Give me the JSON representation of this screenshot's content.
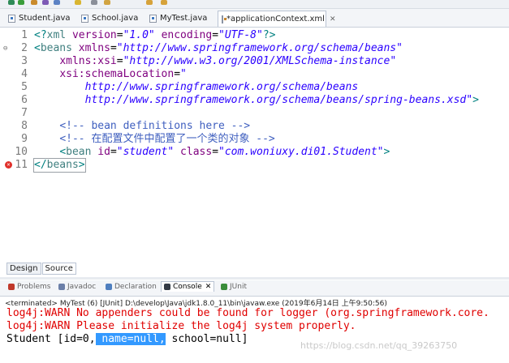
{
  "tabs": [
    {
      "label": "Student.java",
      "icon": "java-file-icon",
      "active": false
    },
    {
      "label": "School.java",
      "icon": "java-file-icon",
      "active": false
    },
    {
      "label": "MyTest.java",
      "icon": "java-file-icon",
      "active": false
    },
    {
      "label": "*applicationContext.xml",
      "icon": "xml-file-icon",
      "active": true,
      "close": "✕"
    }
  ],
  "editor": {
    "lines": [
      {
        "num": "1",
        "parts": [
          [
            "punct",
            "<?"
          ],
          [
            "tag",
            "xml "
          ],
          [
            "attr",
            "version"
          ],
          [
            "plain",
            "="
          ],
          [
            "str",
            "\"1.0\""
          ],
          [
            "plain",
            " "
          ],
          [
            "attr",
            "encoding"
          ],
          [
            "plain",
            "="
          ],
          [
            "str",
            "\"UTF-8\""
          ],
          [
            "punct",
            "?>"
          ]
        ]
      },
      {
        "num": "2",
        "fold": "⊖",
        "parts": [
          [
            "punct",
            "<"
          ],
          [
            "tag",
            "beans "
          ],
          [
            "attr",
            "xmlns"
          ],
          [
            "plain",
            "="
          ],
          [
            "str",
            "\"http://www.springframework.org/schema/beans\""
          ]
        ]
      },
      {
        "num": "3",
        "parts": [
          [
            "plain",
            "    "
          ],
          [
            "attr",
            "xmlns:xsi"
          ],
          [
            "plain",
            "="
          ],
          [
            "str",
            "\"http://www.w3.org/2001/XMLSchema-instance\""
          ]
        ]
      },
      {
        "num": "4",
        "parts": [
          [
            "plain",
            "    "
          ],
          [
            "attr",
            "xsi:schemaLocation"
          ],
          [
            "plain",
            "="
          ],
          [
            "str",
            "\""
          ]
        ]
      },
      {
        "num": "5",
        "parts": [
          [
            "plain",
            "        "
          ],
          [
            "str",
            "http://www.springframework.org/schema/beans"
          ]
        ]
      },
      {
        "num": "6",
        "parts": [
          [
            "plain",
            "        "
          ],
          [
            "str",
            "http://www.springframework.org/schema/beans/spring-beans.xsd\""
          ],
          [
            "punct",
            ">"
          ]
        ]
      },
      {
        "num": "7",
        "parts": []
      },
      {
        "num": "8",
        "parts": [
          [
            "plain",
            "    "
          ],
          [
            "cmt",
            "<!-- bean definitions here -->"
          ]
        ]
      },
      {
        "num": "9",
        "parts": [
          [
            "plain",
            "    "
          ],
          [
            "cmt",
            "<!-- 在配置文件中配置了一个类的对象 -->"
          ]
        ]
      },
      {
        "num": "10",
        "parts": [
          [
            "plain",
            "    "
          ],
          [
            "punct",
            "<"
          ],
          [
            "tag",
            "bean "
          ],
          [
            "attr",
            "id"
          ],
          [
            "plain",
            "="
          ],
          [
            "str",
            "\"student\""
          ],
          [
            "plain",
            " "
          ],
          [
            "attr",
            "class"
          ],
          [
            "plain",
            "="
          ],
          [
            "str",
            "\"com.woniuxy.di01.Student\""
          ],
          [
            "punct",
            ">"
          ]
        ]
      },
      {
        "num": "11",
        "error": true,
        "parts": [
          [
            "punct",
            "</"
          ],
          [
            "tag",
            "beans"
          ],
          [
            "punct",
            ">"
          ]
        ]
      }
    ]
  },
  "bottom_tabs": {
    "design": "Design",
    "source": "Source"
  },
  "views": [
    {
      "label": "Problems",
      "icon": "problems-icon"
    },
    {
      "label": "Javadoc",
      "icon": "javadoc-icon"
    },
    {
      "label": "Declaration",
      "icon": "declaration-icon"
    },
    {
      "label": "Console",
      "icon": "console-icon",
      "active": true,
      "close": "✕"
    },
    {
      "label": "JUnit",
      "icon": "junit-icon"
    }
  ],
  "console": {
    "status": "<terminated> MyTest (6) [JUnit] D:\\develop\\Java\\jdk1.8.0_11\\bin\\javaw.exe (2019年6月14日 上午9:50:56)",
    "line1": "log4j:WARN No appenders could be found for logger (org.springframework.core.",
    "line2": "log4j:WARN Please initialize the log4j system properly.",
    "line3_prefix": "Student [id=0,",
    "line3_selected": " name=null,",
    "line3_suffix": " school=null]"
  },
  "watermark": "https://blog.csdn.net/qq_39263750",
  "colors": {
    "tag": "#3f7f7f",
    "attr": "#7f007f",
    "string": "#2a00ff",
    "comment": "#3f5fbf",
    "warn": "#e00000",
    "selection": "#3399ff"
  }
}
